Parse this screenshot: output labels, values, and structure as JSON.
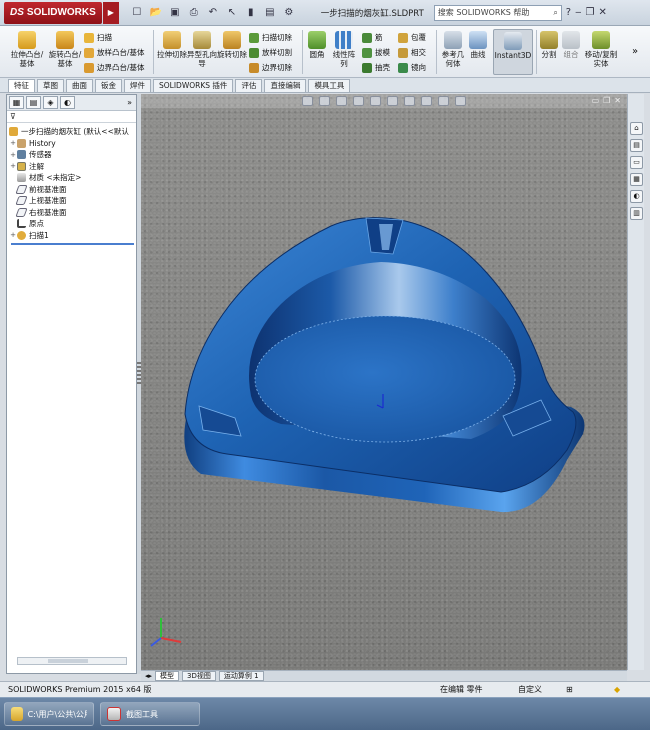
{
  "app": {
    "logo_text": "SOLIDWORKS",
    "logo_prefix": "DS",
    "doc_title": "一步扫描的烟灰缸.SLDPRT",
    "help_search_placeholder": "搜索 SOLIDWORKS 帮助"
  },
  "command_manager": {
    "big_buttons": [
      "拉伸凸台/基体",
      "旋转凸台/基体",
      "拉伸切除",
      "异型孔向导",
      "旋转切除",
      "圆角",
      "线性阵列",
      "参考几何体",
      "曲线",
      "Instant3D",
      "分割",
      "组合",
      "移动/复制实体"
    ],
    "small_buttons": [
      "扫描",
      "放样凸台/基体",
      "边界凸台/基体",
      "扫描切除",
      "放样切割",
      "边界切除",
      "筋",
      "拔模",
      "抽壳",
      "包覆",
      "相交",
      "镜向"
    ]
  },
  "tabs": [
    "特征",
    "草图",
    "曲面",
    "钣金",
    "焊件",
    "SOLIDWORKS 插件",
    "评估",
    "直接编辑",
    "模具工具"
  ],
  "active_tab": "特征",
  "feature_tree": {
    "filter_icon": "funnel-icon",
    "root": "一步扫描的烟灰缸 (默认<<默认",
    "items": [
      {
        "label": "History",
        "icon": "history-icon",
        "expandable": true
      },
      {
        "label": "传感器",
        "icon": "sensor-icon",
        "expandable": true
      },
      {
        "label": "注解",
        "icon": "annotation-icon",
        "expandable": true
      },
      {
        "label": "材质 <未指定>",
        "icon": "material-icon",
        "expandable": false
      },
      {
        "label": "前视基准面",
        "icon": "plane-icon",
        "expandable": false
      },
      {
        "label": "上视基准面",
        "icon": "plane-icon",
        "expandable": false
      },
      {
        "label": "右视基准面",
        "icon": "plane-icon",
        "expandable": false
      },
      {
        "label": "原点",
        "icon": "origin-icon",
        "expandable": false
      },
      {
        "label": "扫描1",
        "icon": "sweep-icon",
        "expandable": true
      }
    ]
  },
  "model_tabs": [
    "模型",
    "3D视图",
    "运动算例 1"
  ],
  "status": {
    "product": "SOLIDWORKS Premium 2015 x64 版",
    "mode": "在编辑 零件",
    "units": "自定义"
  },
  "taskbar": [
    {
      "label": "C:\\用户\\公共\\公用...",
      "icon": "folder-icon"
    },
    {
      "label": "截图工具",
      "icon": "scissors-icon"
    }
  ],
  "colors": {
    "model_blue": "#1f5fa8",
    "logo_red": "#b3232a",
    "viewport_grey": "#868684",
    "taskbar_blue": "#5a7697"
  }
}
